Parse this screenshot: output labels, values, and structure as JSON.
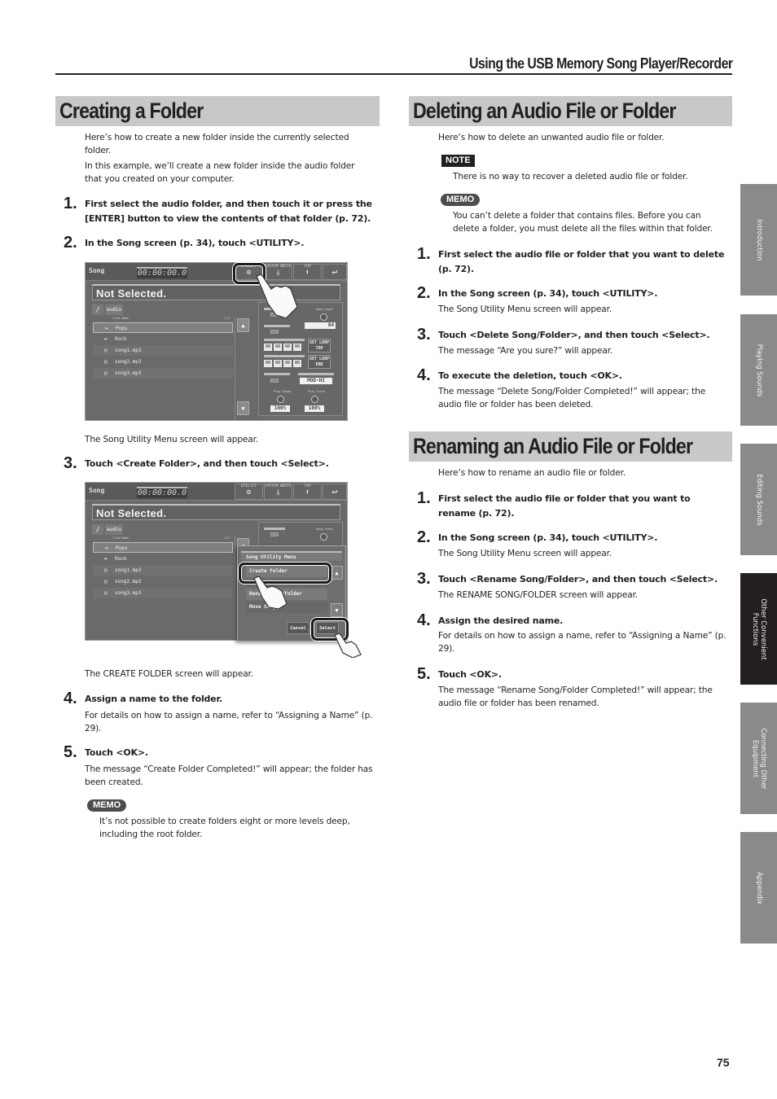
{
  "header": {
    "title": "Using the USB Memory Song Player/Recorder"
  },
  "page_number": "75",
  "side_tabs": [
    {
      "label": "Introduction",
      "active": false
    },
    {
      "label": "Playing Sounds",
      "active": false
    },
    {
      "label": "Editing Sounds",
      "active": false
    },
    {
      "label": "Other Convenient Functions",
      "active": true
    },
    {
      "label": "Connecting Other Equipment",
      "active": false
    },
    {
      "label": "Appendix",
      "active": false
    }
  ],
  "creating": {
    "title": "Creating a Folder",
    "intro1": "Here’s how to create a new folder inside the currently selected folder.",
    "intro2": "In this example, we’ll create a new folder inside the audio folder that you created on your computer.",
    "steps": [
      {
        "num": "1.",
        "text": "First select the audio folder, and then touch it or press the [ENTER] button to view the contents of that folder (p. 72).",
        "note": ""
      },
      {
        "num": "2.",
        "text": "In the Song screen (p. 34), touch <UTILITY>.",
        "note": "The Song Utility Menu screen will appear."
      },
      {
        "num": "3.",
        "text": "Touch <Create Folder>, and then touch <Select>.",
        "note": "The CREATE FOLDER screen will appear."
      },
      {
        "num": "4.",
        "text": "Assign a name to the folder.",
        "note": "For details on how to assign a name, refer to “Assigning a Name” (p. 29)."
      },
      {
        "num": "5.",
        "text": "Touch <OK>.",
        "note": "The message “Create Folder Completed!” will appear; the folder has been created."
      }
    ],
    "memo_label": "MEMO",
    "memo_text": "It’s not possible to create folders eight or more levels deep, including the root folder."
  },
  "deleting": {
    "title": "Deleting an Audio File or Folder",
    "intro": "Here’s how to delete an unwanted audio file or folder.",
    "note_label": "NOTE",
    "note_text": "There is no way to recover a deleted audio file or folder.",
    "memo_label": "MEMO",
    "memo_text": "You can’t delete a folder that contains files. Before you can delete a folder, you must delete all the files within that folder.",
    "steps": [
      {
        "num": "1.",
        "text": "First select the audio file or folder that you want to delete (p. 72).",
        "note": ""
      },
      {
        "num": "2.",
        "text": "In the Song screen (p. 34), touch <UTILITY>.",
        "note": "The Song Utility Menu screen will appear."
      },
      {
        "num": "3.",
        "text": "Touch <Delete Song/Folder>, and then touch <Select>.",
        "note": "The message “Are you sure?” will appear."
      },
      {
        "num": "4.",
        "text": "To execute the deletion, touch <OK>.",
        "note": "The message “Delete Song/Folder Completed!” will appear; the audio file or folder has been deleted."
      }
    ]
  },
  "renaming": {
    "title": "Renaming an Audio File or Folder",
    "intro": "Here’s how to rename an audio file or folder.",
    "steps": [
      {
        "num": "1.",
        "text": "First select the audio file or folder that you want to rename (p. 72).",
        "note": ""
      },
      {
        "num": "2.",
        "text": "In the Song screen (p. 34), touch <UTILITY>.",
        "note": "The Song Utility Menu screen will appear."
      },
      {
        "num": "3.",
        "text": "Touch <Rename Song/Folder>, and then touch <Select>.",
        "note": "The RENAME SONG/FOLDER screen will appear."
      },
      {
        "num": "4.",
        "text": "Assign the desired name.",
        "note": "For details on how to assign a name, refer to “Assigning a Name” (p. 29)."
      },
      {
        "num": "5.",
        "text": "Touch <OK>.",
        "note": "The message “Rename Song/Folder Completed!” will appear; the audio file or folder has been renamed."
      }
    ]
  },
  "song_screen": {
    "screen_label": "Song",
    "timer": "00:00:00.0",
    "buttons": {
      "utility": "UTILITY",
      "system_write": "SYSTEM WRITE",
      "top": "TOP"
    },
    "song_name": "Not Selected.",
    "path_root": "/",
    "path_folder": "audio",
    "list_header": "File Name",
    "list_count": "1/3",
    "files": [
      {
        "name": "Pops",
        "type": "folder"
      },
      {
        "name": "Rock",
        "type": "folder"
      },
      {
        "name": "song1.mp3",
        "type": "file"
      },
      {
        "name": "song2.mp3",
        "type": "file"
      },
      {
        "name": "song3.mp3",
        "type": "file"
      }
    ],
    "song_level_label": "Song Level",
    "song_level": "84",
    "loop_top_time": [
      "00",
      "00",
      "00",
      "00"
    ],
    "loop_end_time": [
      "00",
      "00",
      "00",
      "00"
    ],
    "set_loop_top": "SET LOOP TOP",
    "set_loop_end": "SET LOOP END",
    "center_cancel_type": "MOD-HI",
    "play_speed_label": "Play Speed",
    "play_speed": "100%",
    "play_pitch_label": "Play Pitch",
    "play_pitch": "100%"
  },
  "utility_menu": {
    "title": "Song Utility Menu",
    "items": [
      "Create Folder",
      "Delete Song/Folder",
      "Rename Song/Folder",
      "Move Song/Folder"
    ],
    "visible_items": [
      "Create Folder",
      "",
      "Renam",
      "Move Song/"
    ],
    "cancel": "Cancel",
    "select": "Select"
  }
}
